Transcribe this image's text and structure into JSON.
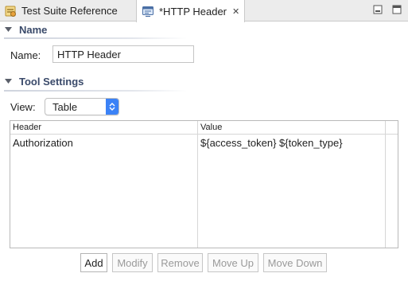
{
  "tabs": [
    {
      "label": "Test Suite Reference",
      "icon": "test-suite-icon",
      "active": false
    },
    {
      "label": "*HTTP Header",
      "icon": "http-header-icon",
      "active": true,
      "close_icon": "close-icon"
    }
  ],
  "window_controls": [
    "minimize-icon",
    "maximize-icon"
  ],
  "name_section": {
    "title": "Name",
    "label": "Name:",
    "value": "HTTP Header"
  },
  "tool_section": {
    "title": "Tool Settings",
    "view_label": "View:",
    "view_value": "Table"
  },
  "table": {
    "columns": [
      "Header",
      "Value"
    ],
    "rows": [
      {
        "header": "Authorization",
        "value": "${access_token} ${token_type}"
      }
    ]
  },
  "buttons": [
    {
      "label": "Add",
      "enabled": true
    },
    {
      "label": "Modify",
      "enabled": false
    },
    {
      "label": "Remove",
      "enabled": false
    },
    {
      "label": "Move Up",
      "enabled": false
    },
    {
      "label": "Move Down",
      "enabled": false
    }
  ],
  "colors": {
    "section_title": "#3a4a6a",
    "select_accent": "#3b82f6",
    "tab_bar": "#ececec"
  }
}
